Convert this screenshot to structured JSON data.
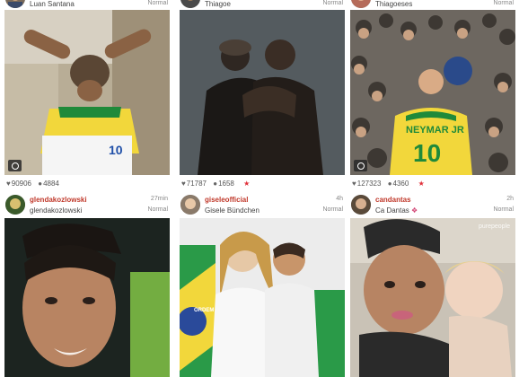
{
  "posts": [
    {
      "username": "",
      "display_name": "Luan Santana",
      "time": "",
      "filter": "Normal",
      "likes": "90906",
      "comments": "4884",
      "starred": false,
      "jersey_text": "10"
    },
    {
      "username": "",
      "display_name": "Thiagoe",
      "time": "",
      "filter": "Normal",
      "likes": "71787",
      "comments": "1658",
      "starred": true
    },
    {
      "username": "",
      "display_name": "Thiagoeses",
      "time": "",
      "filter": "Normal",
      "likes": "127323",
      "comments": "4360",
      "starred": true,
      "jersey_text": "NEYMAR JR",
      "jersey_number": "10"
    },
    {
      "username": "glendakozlowski",
      "display_name": "glendakozlowski",
      "time": "27min",
      "filter": "Normal"
    },
    {
      "username": "giseleofficial",
      "display_name": "Gisele Bündchen",
      "time": "4h",
      "filter": "Normal",
      "flag_text": "ORDEM"
    },
    {
      "username": "candantas",
      "display_name": "Ca Dantas",
      "time": "2h",
      "filter": "Normal"
    }
  ],
  "watermark": "purepeople",
  "icons": {
    "heart": "heart-icon",
    "comment": "comment-icon",
    "star": "star-icon",
    "camera": "camera-icon"
  },
  "colors": {
    "username": "#c0392b",
    "star": "#e0303a"
  }
}
